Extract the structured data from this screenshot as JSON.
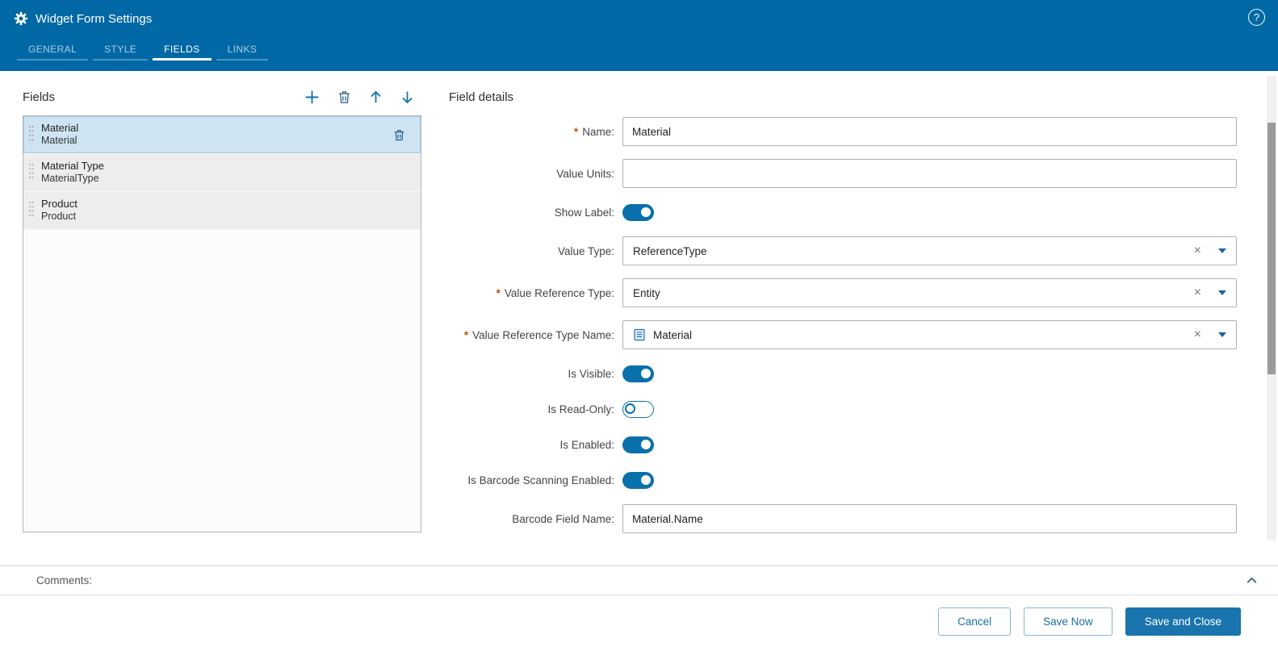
{
  "header": {
    "title": "Widget Form Settings",
    "tabs": [
      {
        "label": "GENERAL",
        "active": false
      },
      {
        "label": "STYLE",
        "active": false
      },
      {
        "label": "FIELDS",
        "active": true
      },
      {
        "label": "LINKS",
        "active": false
      }
    ]
  },
  "icons": {
    "help": "?",
    "clear": "×"
  },
  "fields_panel": {
    "title": "Fields",
    "items": [
      {
        "name": "Material",
        "binding": "Material",
        "selected": true
      },
      {
        "name": "Material Type",
        "binding": "MaterialType",
        "selected": false
      },
      {
        "name": "Product",
        "binding": "Product",
        "selected": false
      }
    ]
  },
  "details": {
    "title": "Field details",
    "name": {
      "label": "Name:",
      "required_mark": "*",
      "value": "Material"
    },
    "value_units": {
      "label": "Value Units:",
      "value": ""
    },
    "show_label": {
      "label": "Show Label:",
      "on": true
    },
    "value_type": {
      "label": "Value Type:",
      "value": "ReferenceType"
    },
    "value_reference_type": {
      "label": "Value Reference Type:",
      "required_mark": "*",
      "value": "Entity"
    },
    "value_reference_type_name": {
      "label": "Value Reference Type Name:",
      "required_mark": "*",
      "value": "Material"
    },
    "is_visible": {
      "label": "Is Visible:",
      "on": true
    },
    "is_read_only": {
      "label": "Is Read-Only:",
      "on": false
    },
    "is_enabled": {
      "label": "Is Enabled:",
      "on": true
    },
    "is_barcode": {
      "label": "Is Barcode Scanning Enabled:",
      "on": true
    },
    "barcode_field_name": {
      "label": "Barcode Field Name:",
      "value": "Material.Name"
    }
  },
  "comments": {
    "label": "Comments:"
  },
  "footer": {
    "cancel": "Cancel",
    "save_now": "Save Now",
    "save_and_close": "Save and Close"
  },
  "colors": {
    "header_blue": "#0068a5",
    "accent_blue": "#1a74ad",
    "toggle_on": "#0a70ab",
    "required": "#c45911",
    "selected_item": "#cfe4f3"
  }
}
